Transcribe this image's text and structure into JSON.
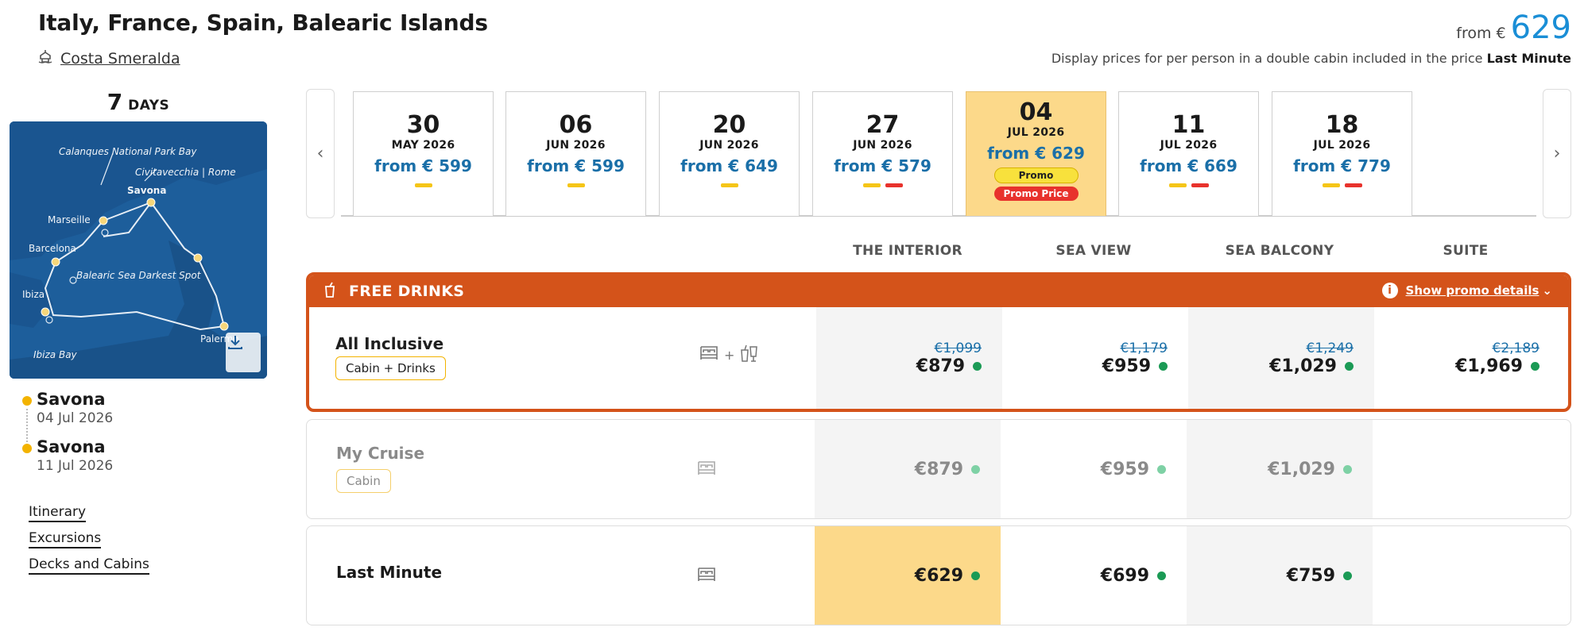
{
  "header": {
    "title": "Italy, France, Spain, Balearic Islands",
    "ship": "Costa Smeralda",
    "from_label": "from €",
    "from_price": "629",
    "note_prefix": "Display prices for per person in a double cabin included in the price",
    "note_bold": "Last Minute"
  },
  "sidebar": {
    "days_num": "7",
    "days_label": "DAYS",
    "map_labels": {
      "calanques": "Calanques National Park Bay",
      "civitavecchia": "Civitavecchia | Rome",
      "savona": "Savona",
      "marseille": "Marseille",
      "barcelona": "Barcelona",
      "balearic": "Balearic Sea Darkest Spot",
      "ibiza": "Ibiza",
      "palermo": "Palermo",
      "ibiza_bay": "Ibiza Bay"
    },
    "departure": {
      "port": "Savona",
      "date": "04 Jul 2026"
    },
    "arrival": {
      "port": "Savona",
      "date": "11 Jul 2026"
    },
    "links": [
      "Itinerary",
      "Excursions",
      "Decks and Cabins"
    ]
  },
  "dates": [
    {
      "day": "30",
      "month": "MAY 2026",
      "price": "from € 599",
      "bars": [
        "y"
      ]
    },
    {
      "day": "06",
      "month": "JUN 2026",
      "price": "from € 599",
      "bars": [
        "y"
      ]
    },
    {
      "day": "20",
      "month": "JUN 2026",
      "price": "from € 649",
      "bars": [
        "y"
      ]
    },
    {
      "day": "27",
      "month": "JUN 2026",
      "price": "from € 579",
      "bars": [
        "y",
        "r"
      ]
    },
    {
      "day": "04",
      "month": "JUL 2026",
      "price": "from € 629",
      "selected": true,
      "promo": "Promo",
      "promo_price": "Promo Price"
    },
    {
      "day": "11",
      "month": "JUL 2026",
      "price": "from € 669",
      "bars": [
        "y",
        "r"
      ]
    },
    {
      "day": "18",
      "month": "JUL 2026",
      "price": "from € 779",
      "bars": [
        "y",
        "r"
      ]
    }
  ],
  "columns": [
    "THE INTERIOR",
    "SEA VIEW",
    "SEA BALCONY",
    "SUITE"
  ],
  "promo": {
    "label": "FREE DRINKS",
    "details": "Show promo details"
  },
  "rows": [
    {
      "name": "All Inclusive",
      "tag": "Cabin + Drinks",
      "icon_plus": "+",
      "prices": [
        {
          "old": "€1,099",
          "cur": "€879"
        },
        {
          "old": "€1,179",
          "cur": "€959"
        },
        {
          "old": "€1,249",
          "cur": "€1,029"
        },
        {
          "old": "€2,189",
          "cur": "€1,969"
        }
      ]
    },
    {
      "name": "My Cruise",
      "tag": "Cabin",
      "prices": [
        {
          "cur": "€879"
        },
        {
          "cur": "€959"
        },
        {
          "cur": "€1,029"
        }
      ]
    },
    {
      "name": "Last Minute",
      "prices": [
        {
          "cur": "€629"
        },
        {
          "cur": "€699"
        },
        {
          "cur": "€759"
        }
      ]
    }
  ],
  "colors": {
    "accent": "#d4531a",
    "selected": "#fcd98a",
    "price_blue": "#1a6fa8",
    "avail": "#1b9a55"
  }
}
